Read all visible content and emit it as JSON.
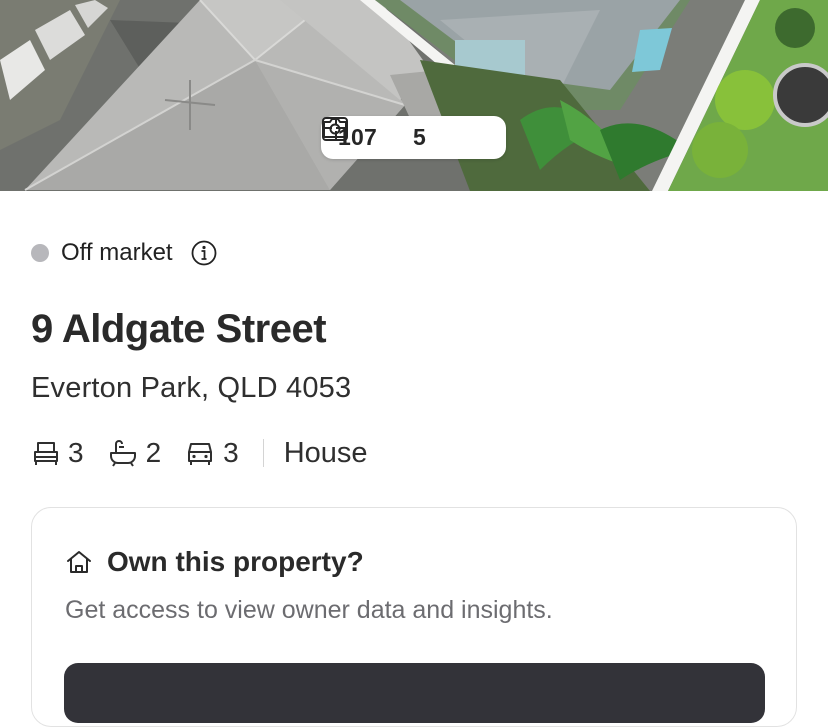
{
  "media": {
    "photo_count": "107",
    "floorplan_count": "5",
    "photo_icon": "camera-icon",
    "floorplan_icon": "floorplan-icon"
  },
  "status": {
    "label": "Off market",
    "dot_color": "#b7b7bb",
    "info_icon": "info-icon"
  },
  "address": {
    "street": "9 Aldgate Street",
    "suburb": "Everton Park, QLD 4053"
  },
  "features": {
    "bedrooms": "3",
    "bathrooms": "2",
    "car_spaces": "3",
    "property_type": "House",
    "bed_icon": "bed-icon",
    "bath_icon": "bath-icon",
    "car_icon": "car-icon"
  },
  "owner_card": {
    "title": "Own this property?",
    "subtitle": "Get access to view owner data and insights.",
    "icon": "home-icon",
    "button_color": "#333339"
  }
}
